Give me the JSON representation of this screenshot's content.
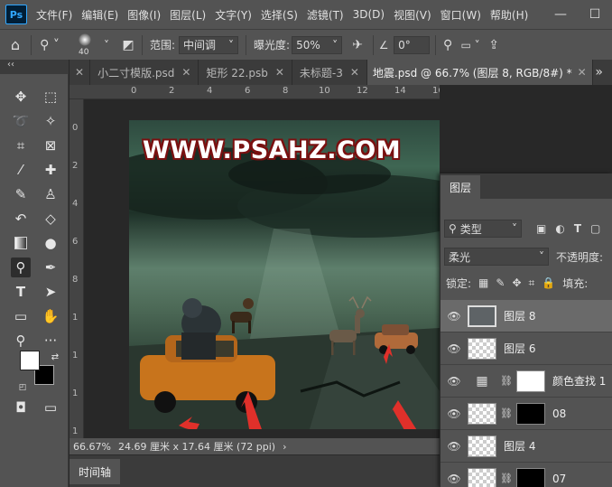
{
  "app": {
    "logo": "Ps"
  },
  "menu": [
    "文件(F)",
    "编辑(E)",
    "图像(I)",
    "图层(L)",
    "文字(Y)",
    "选择(S)",
    "滤镜(T)",
    "3D(D)",
    "视图(V)",
    "窗口(W)",
    "帮助(H)"
  ],
  "window_controls": {
    "minimize": "—",
    "maximize": "☐"
  },
  "options": {
    "brush_size": "40",
    "range_label": "范围:",
    "range_value": "中间调",
    "exposure_label": "曝光度:",
    "exposure_value": "50%",
    "angle_value": "0°"
  },
  "tabs": [
    {
      "label": "小二寸模版.psd"
    },
    {
      "label": "矩形 22.psb"
    },
    {
      "label": "未标题-3"
    },
    {
      "label": "地震.psd @ 66.7% (图层 8, RGB/8#) *"
    }
  ],
  "tabs_overflow": "»",
  "tools_collapse": "‹‹",
  "canvas": {
    "watermark": "WWW.PSAHZ.COM"
  },
  "ruler_top": [
    "0",
    "2",
    "4",
    "6",
    "8",
    "10",
    "12",
    "14",
    "16"
  ],
  "ruler_left": [
    "0",
    "2",
    "4",
    "6",
    "8",
    "1",
    "1",
    "1",
    "1"
  ],
  "status": {
    "zoom": "66.67%",
    "doc_size": "24.69 厘米 x 17.64 厘米 (72 ppi)",
    "arrow": "›"
  },
  "timeline": {
    "label": "时间轴"
  },
  "layers_panel": {
    "title": "图层",
    "filter_kind": "类型",
    "blend_mode": "柔光",
    "opacity_label": "不透明度:",
    "lock_label": "锁定:",
    "fill_label": "填充:",
    "layers": [
      {
        "name": "图层 8",
        "selected": true,
        "mask": "none"
      },
      {
        "name": "图层 6",
        "selected": false,
        "mask": "none"
      },
      {
        "name": "颜色查找 1",
        "selected": false,
        "mask": "white"
      },
      {
        "name": "08",
        "selected": false,
        "mask": "black"
      },
      {
        "name": "图层 4",
        "selected": false,
        "mask": "none"
      },
      {
        "name": "07",
        "selected": false,
        "mask": "black"
      }
    ]
  },
  "colors": {
    "menubar": "#535353",
    "panel": "#535353",
    "dark": "#282828",
    "watermark_outline": "#7a1010",
    "arrow_red": "#e0302a"
  }
}
